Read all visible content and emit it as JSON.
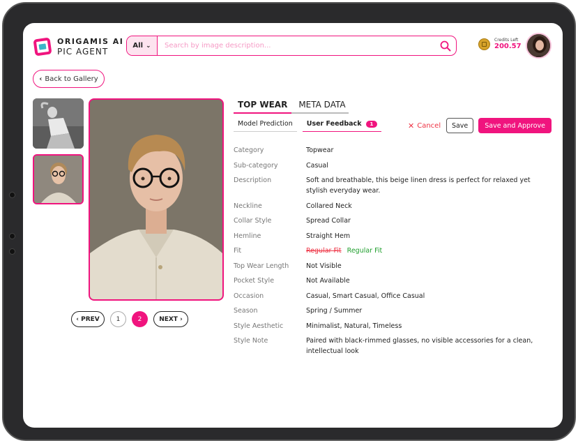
{
  "header": {
    "logo_line1": "ORIGAMIS AI",
    "logo_line2": "PIC AGENT",
    "search_category": "All",
    "search_placeholder": "Search by image description...",
    "credits_label": "Credits Left",
    "credits_value": "200.57"
  },
  "nav": {
    "back_label": "Back to Gallery"
  },
  "tabs": [
    {
      "label": "TOP WEAR",
      "active": true
    },
    {
      "label": "META DATA",
      "active": false
    }
  ],
  "subtabs": {
    "model_prediction": "Model Prediction",
    "user_feedback": "User Feedback",
    "feedback_count": "1"
  },
  "actions": {
    "cancel": "Cancel",
    "save": "Save",
    "save_approve": "Save and Approve"
  },
  "attributes": [
    {
      "label": "Category",
      "value": "Topwear"
    },
    {
      "label": "Sub-category",
      "value": "Casual"
    },
    {
      "label": "Description",
      "value": "Soft and breathable, this beige linen dress is perfect for relaxed yet stylish everyday wear."
    },
    {
      "label": "Neckline",
      "value": "Collared Neck"
    },
    {
      "label": "Collar Style",
      "value": "Spread Collar"
    },
    {
      "label": "Hemline",
      "value": "Straight Hem"
    },
    {
      "label": "Fit",
      "old_value": "Regular Fit",
      "value": "Regular Fit"
    },
    {
      "label": "Top Wear Length",
      "value": "Not Visible"
    },
    {
      "label": "Pocket Style",
      "value": "Not Available"
    },
    {
      "label": "Occasion",
      "value": "Casual, Smart Casual, Office Casual"
    },
    {
      "label": "Season",
      "value": "Spring / Summer"
    },
    {
      "label": "Style Aesthetic",
      "value": "Minimalist, Natural, Timeless"
    },
    {
      "label": "Style Note",
      "value": "Paired with black-rimmed glasses, no visible accessories for a clean, intellectual look"
    }
  ],
  "pagination": {
    "prev": "PREV",
    "next": "NEXT",
    "pages": [
      "1",
      "2"
    ],
    "current": "2"
  },
  "colors": {
    "accent": "#f0147e",
    "cancel": "#ee3344",
    "corrected": "#1e9e2c"
  }
}
